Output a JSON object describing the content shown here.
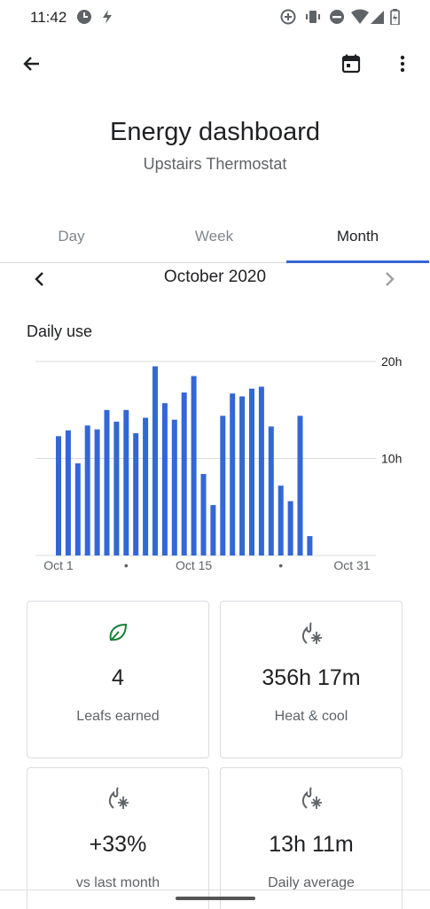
{
  "status_bar": {
    "time": "11:42"
  },
  "header": {
    "title": "Energy dashboard",
    "subtitle": "Upstairs Thermostat"
  },
  "tabs": [
    {
      "label": "Day",
      "active": false
    },
    {
      "label": "Week",
      "active": false
    },
    {
      "label": "Month",
      "active": true
    }
  ],
  "period": {
    "label": "October 2020"
  },
  "section": {
    "daily_use_title": "Daily use"
  },
  "chart_data": {
    "type": "bar",
    "categories": [
      "1",
      "2",
      "3",
      "4",
      "5",
      "6",
      "7",
      "8",
      "9",
      "10",
      "11",
      "12",
      "13",
      "14",
      "15",
      "16",
      "17",
      "18",
      "19",
      "20",
      "21",
      "22",
      "23",
      "24",
      "25",
      "26",
      "27",
      "28",
      "29",
      "30",
      "31"
    ],
    "values": [
      12.3,
      12.9,
      9.5,
      13.4,
      13.0,
      15.0,
      13.8,
      15.0,
      12.6,
      14.2,
      19.5,
      15.7,
      14.0,
      16.8,
      18.5,
      8.4,
      5.2,
      14.4,
      16.7,
      16.4,
      17.2,
      17.4,
      13.3,
      7.2,
      5.6,
      14.4,
      2.0,
      null,
      null,
      null,
      null
    ],
    "x_tick_labels": [
      "Oct 1",
      "•",
      "Oct 15",
      "•",
      "Oct 31"
    ],
    "y_tick_labels": [
      "20h",
      "10h"
    ],
    "ylim": [
      0,
      20
    ],
    "color": "#3367d6",
    "grid": true
  },
  "cards": [
    {
      "icon": "leaf-icon",
      "value": "4",
      "label": "Leafs earned",
      "icon_color": "#188038"
    },
    {
      "icon": "heat-cool-icon",
      "value": "356h 17m",
      "label": "Heat & cool",
      "icon_color": "#5f6368"
    },
    {
      "icon": "heat-cool-icon",
      "value": "+33%",
      "label": "vs last month",
      "icon_color": "#5f6368"
    },
    {
      "icon": "heat-cool-icon",
      "value": "13h 11m",
      "label": "Daily average",
      "icon_color": "#5f6368"
    }
  ]
}
